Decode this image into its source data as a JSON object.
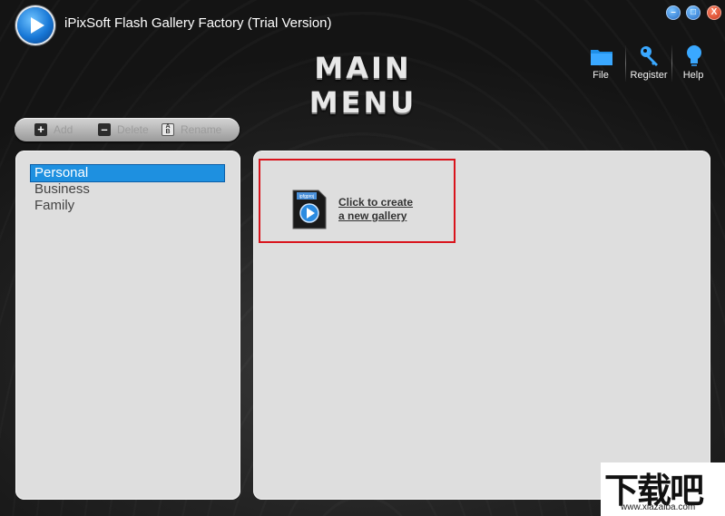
{
  "app": {
    "title": "iPixSoft Flash Gallery Factory (Trial Version)",
    "main_menu_title": "MAIN MENU"
  },
  "window_controls": {
    "minimize_icon": "minimize-icon",
    "maximize_icon": "maximize-icon",
    "close_label": "X"
  },
  "toolbar": {
    "items": [
      {
        "label": "File",
        "icon": "folder-icon"
      },
      {
        "label": "Register",
        "icon": "key-icon"
      },
      {
        "label": "Help",
        "icon": "bulb-icon"
      }
    ]
  },
  "gallery_actions": {
    "add_label": "Add",
    "delete_label": "Delete",
    "rename_label": "Rename"
  },
  "galleries": {
    "items": [
      {
        "label": "Personal",
        "selected": true
      },
      {
        "label": "Business",
        "selected": false
      },
      {
        "label": "Family",
        "selected": false
      }
    ]
  },
  "main_panel": {
    "create_line1": "Click to create",
    "create_line2": "a new gallery",
    "doc_icon_label": "ipfgproj"
  },
  "watermark": {
    "text": "下载吧",
    "url": "www.xiazaiba.com"
  },
  "colors": {
    "selection": "#1e90e0",
    "highlight_border": "#d9141c",
    "panel_bg": "#dedede"
  }
}
